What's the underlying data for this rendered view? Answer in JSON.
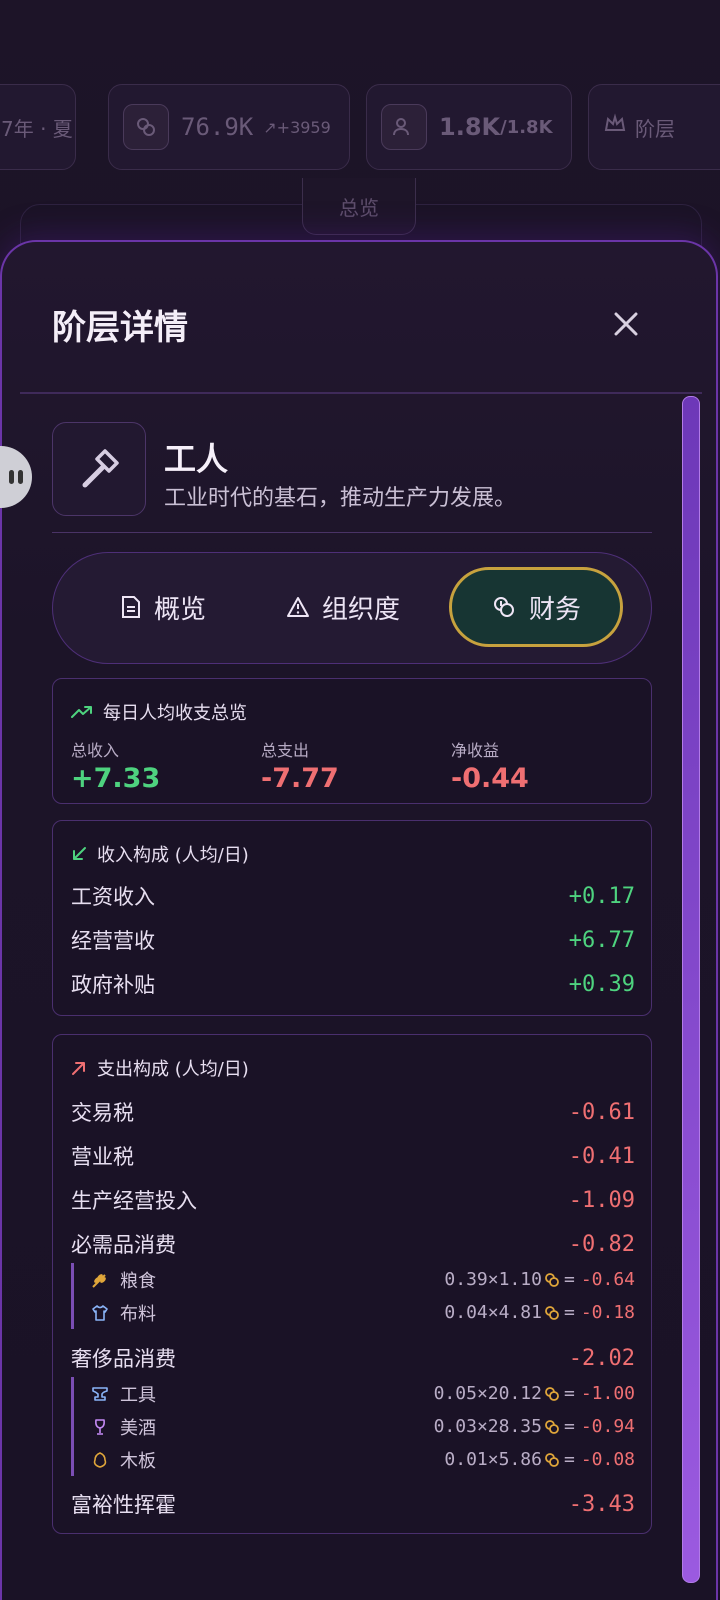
{
  "background": {
    "chips": [
      {
        "text": "7年 · 夏"
      },
      {
        "value": "76.9K",
        "delta": "+3959"
      },
      {
        "value": "1.8K",
        "sub": "/1.8K"
      },
      {
        "text": "阶层"
      }
    ],
    "tab_label": "总览"
  },
  "modal": {
    "title": "阶层详情",
    "stratum": {
      "name": "工人",
      "description": "工业时代的基石，推动生产力发展。",
      "icon": "hammer-icon"
    },
    "tabs": [
      {
        "label": "概览",
        "icon": "document-icon",
        "active": false
      },
      {
        "label": "组织度",
        "icon": "warning-icon",
        "active": false
      },
      {
        "label": "财务",
        "icon": "coins-icon",
        "active": true
      }
    ],
    "summary": {
      "title": "每日人均收支总览",
      "income_label": "总收入",
      "income_value": "+7.33",
      "expense_label": "总支出",
      "expense_value": "-7.77",
      "net_label": "净收益",
      "net_value": "-0.44"
    },
    "income": {
      "title": "收入构成 (人均/日)",
      "rows": [
        {
          "label": "工资收入",
          "value": "+0.17"
        },
        {
          "label": "经营营收",
          "value": "+6.77"
        },
        {
          "label": "政府补贴",
          "value": "+0.39"
        }
      ]
    },
    "expense": {
      "title": "支出构成 (人均/日)",
      "rows": [
        {
          "label": "交易税",
          "value": "-0.61"
        },
        {
          "label": "营业税",
          "value": "-0.41"
        },
        {
          "label": "生产经营投入",
          "value": "-1.09"
        },
        {
          "label": "必需品消费",
          "value": "-0.82"
        },
        {
          "label": "奢侈品消费",
          "value": "-2.02"
        },
        {
          "label": "富裕性挥霍",
          "value": "-3.43"
        }
      ],
      "necessities": [
        {
          "name": "粮食",
          "icon": "wheat-icon",
          "qty": "0.39",
          "price": "1.10",
          "result": "-0.64"
        },
        {
          "name": "布料",
          "icon": "shirt-icon",
          "qty": "0.04",
          "price": "4.81",
          "result": "-0.18"
        }
      ],
      "luxuries": [
        {
          "name": "工具",
          "icon": "anvil-icon",
          "qty": "0.05",
          "price": "20.12",
          "result": "-1.00"
        },
        {
          "name": "美酒",
          "icon": "wine-icon",
          "qty": "0.03",
          "price": "28.35",
          "result": "-0.94"
        },
        {
          "name": "木板",
          "icon": "wood-icon",
          "qty": "0.01",
          "price": "5.86",
          "result": "-0.08"
        }
      ]
    },
    "symbols": {
      "times": "×",
      "equals": "="
    },
    "colors": {
      "accent": "#6b35a8",
      "positive": "#4ed37f",
      "negative": "#ef6f72",
      "active_tab_border": "#c7a23e"
    }
  }
}
